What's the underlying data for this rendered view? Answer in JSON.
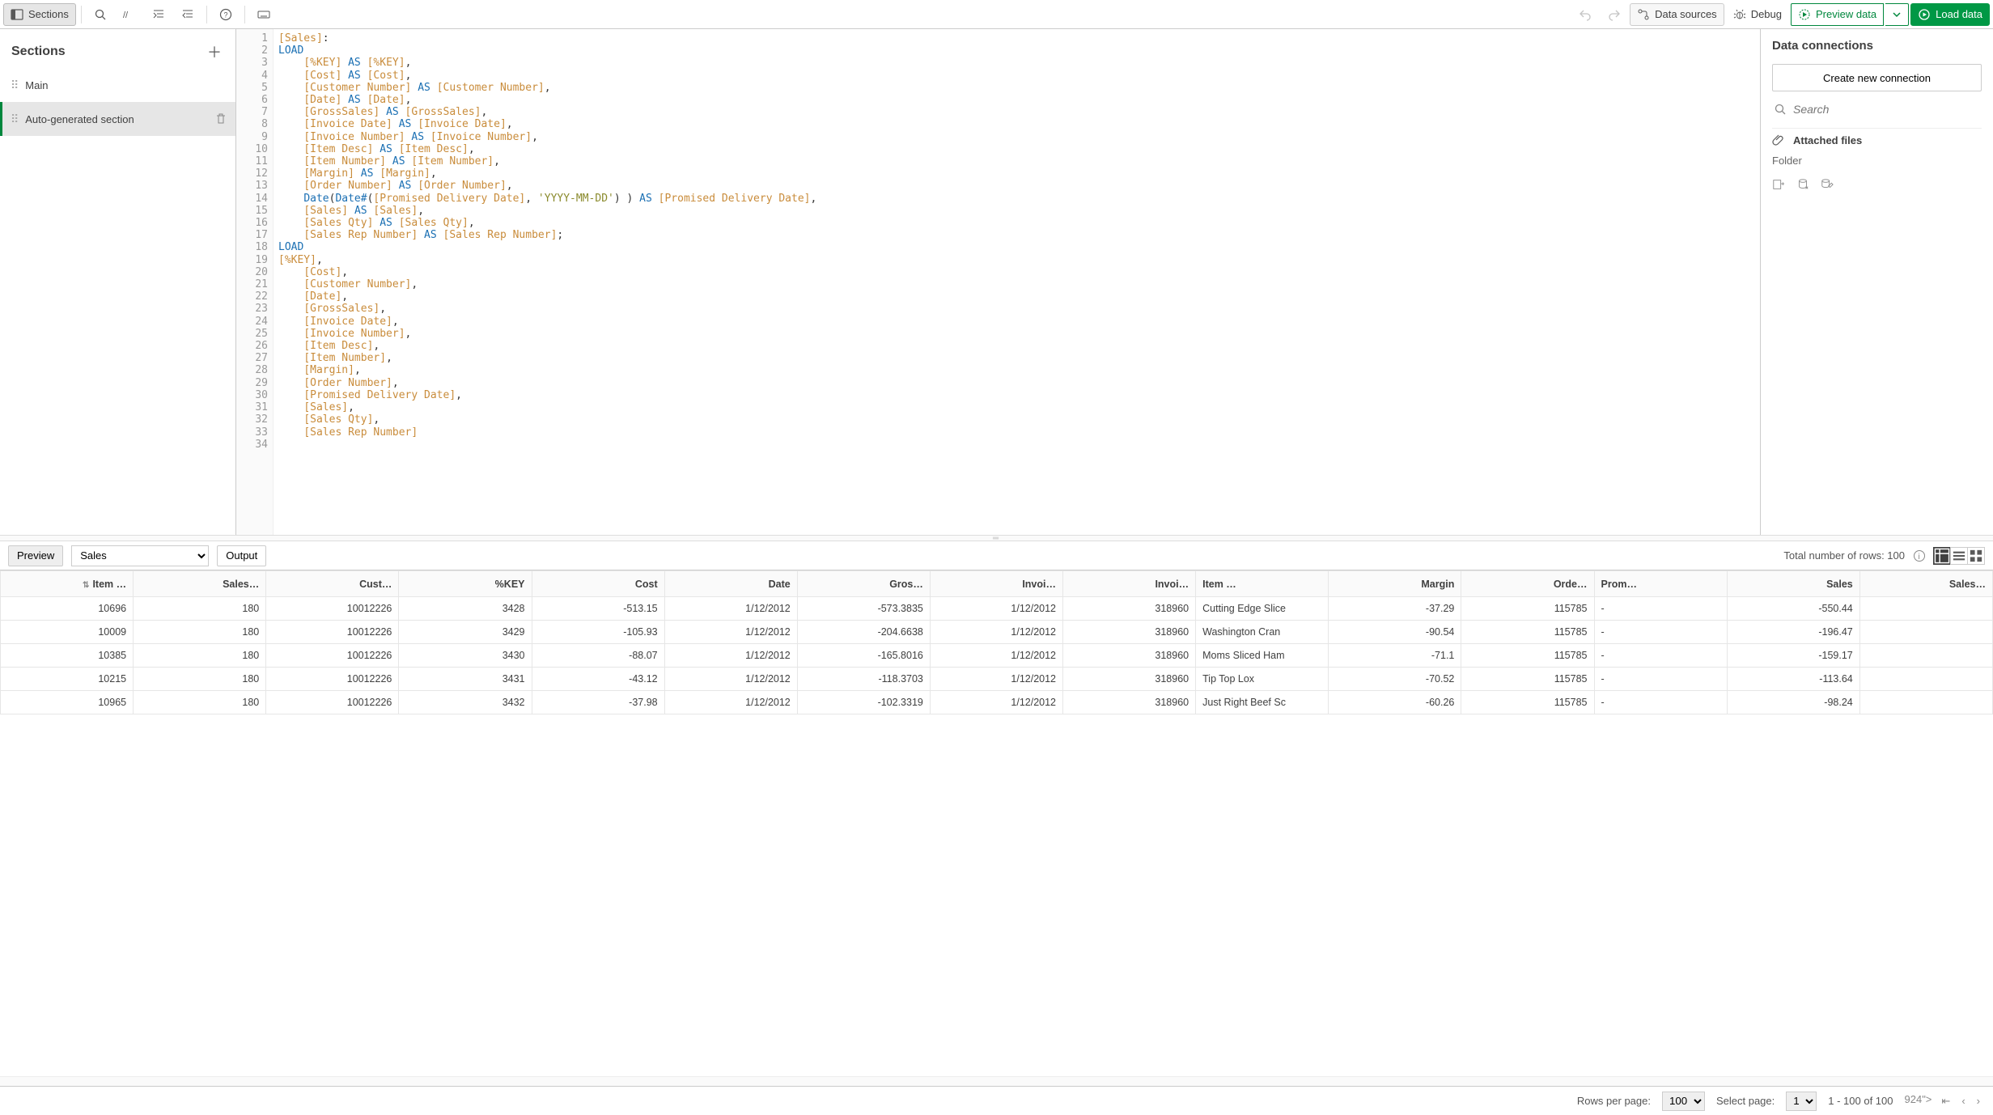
{
  "toolbar": {
    "sections_label": "Sections",
    "data_sources_label": "Data sources",
    "debug_label": "Debug",
    "preview_data_label": "Preview data",
    "load_data_label": "Load data"
  },
  "sections": {
    "title": "Sections",
    "items": [
      {
        "label": "Main",
        "selected": false
      },
      {
        "label": "Auto-generated section",
        "selected": true
      }
    ]
  },
  "editor": {
    "line_count": 34,
    "code_lines": [
      [
        [
          "field",
          "[Sales]"
        ],
        [
          "punc",
          ":"
        ]
      ],
      [
        [
          "kw",
          "LOAD"
        ]
      ],
      [
        [
          "pad",
          "    "
        ],
        [
          "field",
          "[%KEY]"
        ],
        [
          "punc",
          " "
        ],
        [
          "kw",
          "AS"
        ],
        [
          "punc",
          " "
        ],
        [
          "field",
          "[%KEY]"
        ],
        [
          "punc",
          ","
        ]
      ],
      [
        [
          "pad",
          "    "
        ],
        [
          "field",
          "[Cost]"
        ],
        [
          "punc",
          " "
        ],
        [
          "kw",
          "AS"
        ],
        [
          "punc",
          " "
        ],
        [
          "field",
          "[Cost]"
        ],
        [
          "punc",
          ","
        ]
      ],
      [
        [
          "pad",
          "    "
        ],
        [
          "field",
          "[Customer Number]"
        ],
        [
          "punc",
          " "
        ],
        [
          "kw",
          "AS"
        ],
        [
          "punc",
          " "
        ],
        [
          "field",
          "[Customer Number]"
        ],
        [
          "punc",
          ","
        ]
      ],
      [
        [
          "pad",
          "    "
        ],
        [
          "field",
          "[Date]"
        ],
        [
          "punc",
          " "
        ],
        [
          "kw",
          "AS"
        ],
        [
          "punc",
          " "
        ],
        [
          "field",
          "[Date]"
        ],
        [
          "punc",
          ","
        ]
      ],
      [
        [
          "pad",
          "    "
        ],
        [
          "field",
          "[GrossSales]"
        ],
        [
          "punc",
          " "
        ],
        [
          "kw",
          "AS"
        ],
        [
          "punc",
          " "
        ],
        [
          "field",
          "[GrossSales]"
        ],
        [
          "punc",
          ","
        ]
      ],
      [
        [
          "pad",
          "    "
        ],
        [
          "field",
          "[Invoice Date]"
        ],
        [
          "punc",
          " "
        ],
        [
          "kw",
          "AS"
        ],
        [
          "punc",
          " "
        ],
        [
          "field",
          "[Invoice Date]"
        ],
        [
          "punc",
          ","
        ]
      ],
      [
        [
          "pad",
          "    "
        ],
        [
          "field",
          "[Invoice Number]"
        ],
        [
          "punc",
          " "
        ],
        [
          "kw",
          "AS"
        ],
        [
          "punc",
          " "
        ],
        [
          "field",
          "[Invoice Number]"
        ],
        [
          "punc",
          ","
        ]
      ],
      [
        [
          "pad",
          "    "
        ],
        [
          "field",
          "[Item Desc]"
        ],
        [
          "punc",
          " "
        ],
        [
          "kw",
          "AS"
        ],
        [
          "punc",
          " "
        ],
        [
          "field",
          "[Item Desc]"
        ],
        [
          "punc",
          ","
        ]
      ],
      [
        [
          "pad",
          "    "
        ],
        [
          "field",
          "[Item Number]"
        ],
        [
          "punc",
          " "
        ],
        [
          "kw",
          "AS"
        ],
        [
          "punc",
          " "
        ],
        [
          "field",
          "[Item Number]"
        ],
        [
          "punc",
          ","
        ]
      ],
      [
        [
          "pad",
          "    "
        ],
        [
          "field",
          "[Margin]"
        ],
        [
          "punc",
          " "
        ],
        [
          "kw",
          "AS"
        ],
        [
          "punc",
          " "
        ],
        [
          "field",
          "[Margin]"
        ],
        [
          "punc",
          ","
        ]
      ],
      [
        [
          "pad",
          "    "
        ],
        [
          "field",
          "[Order Number]"
        ],
        [
          "punc",
          " "
        ],
        [
          "kw",
          "AS"
        ],
        [
          "punc",
          " "
        ],
        [
          "field",
          "[Order Number]"
        ],
        [
          "punc",
          ","
        ]
      ],
      [
        [
          "pad",
          "    "
        ],
        [
          "fn",
          "Date"
        ],
        [
          "punc",
          "("
        ],
        [
          "fn",
          "Date#"
        ],
        [
          "punc",
          "("
        ],
        [
          "field",
          "[Promised Delivery Date]"
        ],
        [
          "punc",
          ", "
        ],
        [
          "str",
          "'YYYY-MM-DD'"
        ],
        [
          "punc",
          ") ) "
        ],
        [
          "kw",
          "AS"
        ],
        [
          "punc",
          " "
        ],
        [
          "field",
          "[Promised Delivery Date]"
        ],
        [
          "punc",
          ","
        ]
      ],
      [
        [
          "pad",
          "    "
        ],
        [
          "field",
          "[Sales]"
        ],
        [
          "punc",
          " "
        ],
        [
          "kw",
          "AS"
        ],
        [
          "punc",
          " "
        ],
        [
          "field",
          "[Sales]"
        ],
        [
          "punc",
          ","
        ]
      ],
      [
        [
          "pad",
          "    "
        ],
        [
          "field",
          "[Sales Qty]"
        ],
        [
          "punc",
          " "
        ],
        [
          "kw",
          "AS"
        ],
        [
          "punc",
          " "
        ],
        [
          "field",
          "[Sales Qty]"
        ],
        [
          "punc",
          ","
        ]
      ],
      [
        [
          "pad",
          "    "
        ],
        [
          "field",
          "[Sales Rep Number]"
        ],
        [
          "punc",
          " "
        ],
        [
          "kw",
          "AS"
        ],
        [
          "punc",
          " "
        ],
        [
          "field",
          "[Sales Rep Number]"
        ],
        [
          "punc",
          ";"
        ]
      ],
      [
        [
          "kw",
          "LOAD"
        ]
      ],
      [
        [
          "field",
          "[%KEY]"
        ],
        [
          "punc",
          ","
        ]
      ],
      [
        [
          "pad",
          "    "
        ],
        [
          "field",
          "[Cost]"
        ],
        [
          "punc",
          ","
        ]
      ],
      [
        [
          "pad",
          "    "
        ],
        [
          "field",
          "[Customer Number]"
        ],
        [
          "punc",
          ","
        ]
      ],
      [
        [
          "pad",
          "    "
        ],
        [
          "field",
          "[Date]"
        ],
        [
          "punc",
          ","
        ]
      ],
      [
        [
          "pad",
          "    "
        ],
        [
          "field",
          "[GrossSales]"
        ],
        [
          "punc",
          ","
        ]
      ],
      [
        [
          "pad",
          "    "
        ],
        [
          "field",
          "[Invoice Date]"
        ],
        [
          "punc",
          ","
        ]
      ],
      [
        [
          "pad",
          "    "
        ],
        [
          "field",
          "[Invoice Number]"
        ],
        [
          "punc",
          ","
        ]
      ],
      [
        [
          "pad",
          "    "
        ],
        [
          "field",
          "[Item Desc]"
        ],
        [
          "punc",
          ","
        ]
      ],
      [
        [
          "pad",
          "    "
        ],
        [
          "field",
          "[Item Number]"
        ],
        [
          "punc",
          ","
        ]
      ],
      [
        [
          "pad",
          "    "
        ],
        [
          "field",
          "[Margin]"
        ],
        [
          "punc",
          ","
        ]
      ],
      [
        [
          "pad",
          "    "
        ],
        [
          "field",
          "[Order Number]"
        ],
        [
          "punc",
          ","
        ]
      ],
      [
        [
          "pad",
          "    "
        ],
        [
          "field",
          "[Promised Delivery Date]"
        ],
        [
          "punc",
          ","
        ]
      ],
      [
        [
          "pad",
          "    "
        ],
        [
          "field",
          "[Sales]"
        ],
        [
          "punc",
          ","
        ]
      ],
      [
        [
          "pad",
          "    "
        ],
        [
          "field",
          "[Sales Qty]"
        ],
        [
          "punc",
          ","
        ]
      ],
      [
        [
          "pad",
          "    "
        ],
        [
          "field",
          "[Sales Rep Number]"
        ]
      ],
      [
        [
          "pad",
          ""
        ]
      ]
    ]
  },
  "connections": {
    "title": "Data connections",
    "create_btn": "Create new connection",
    "search_placeholder": "Search",
    "attached_label": "Attached files",
    "folder_label": "Folder"
  },
  "preview": {
    "preview_tab": "Preview",
    "output_tab": "Output",
    "table_select": "Sales",
    "total_rows_label": "Total number of rows: 100",
    "columns": [
      "Item …",
      "Sales…",
      "Cust…",
      "%KEY",
      "Cost",
      "Date",
      "Gros…",
      "Invoi…",
      "Invoi…",
      "Item …",
      "Margin",
      "Orde…",
      "Prom…",
      "Sales",
      "Sales…"
    ],
    "column_align": [
      "r",
      "r",
      "r",
      "r",
      "r",
      "r",
      "r",
      "r",
      "r",
      "l",
      "r",
      "r",
      "l",
      "r",
      "r"
    ],
    "rows": [
      [
        "10696",
        "180",
        "10012226",
        "3428",
        "-513.15",
        "1/12/2012",
        "-573.3835",
        "1/12/2012",
        "318960",
        "Cutting Edge Slice",
        "-37.29",
        "115785",
        "-",
        "-550.44",
        ""
      ],
      [
        "10009",
        "180",
        "10012226",
        "3429",
        "-105.93",
        "1/12/2012",
        "-204.6638",
        "1/12/2012",
        "318960",
        "Washington Cran",
        "-90.54",
        "115785",
        "-",
        "-196.47",
        ""
      ],
      [
        "10385",
        "180",
        "10012226",
        "3430",
        "-88.07",
        "1/12/2012",
        "-165.8016",
        "1/12/2012",
        "318960",
        "Moms Sliced Ham",
        "-71.1",
        "115785",
        "-",
        "-159.17",
        ""
      ],
      [
        "10215",
        "180",
        "10012226",
        "3431",
        "-43.12",
        "1/12/2012",
        "-118.3703",
        "1/12/2012",
        "318960",
        "Tip Top Lox",
        "-70.52",
        "115785",
        "-",
        "-113.64",
        ""
      ],
      [
        "10965",
        "180",
        "10012226",
        "3432",
        "-37.98",
        "1/12/2012",
        "-102.3319",
        "1/12/2012",
        "318960",
        "Just Right Beef Sc",
        "-60.26",
        "115785",
        "-",
        "-98.24",
        ""
      ]
    ]
  },
  "pager": {
    "rows_per_page_label": "Rows per page:",
    "rows_per_page_value": "100",
    "select_page_label": "Select page:",
    "select_page_value": "1",
    "range_label": "1 - 100 of 100"
  }
}
